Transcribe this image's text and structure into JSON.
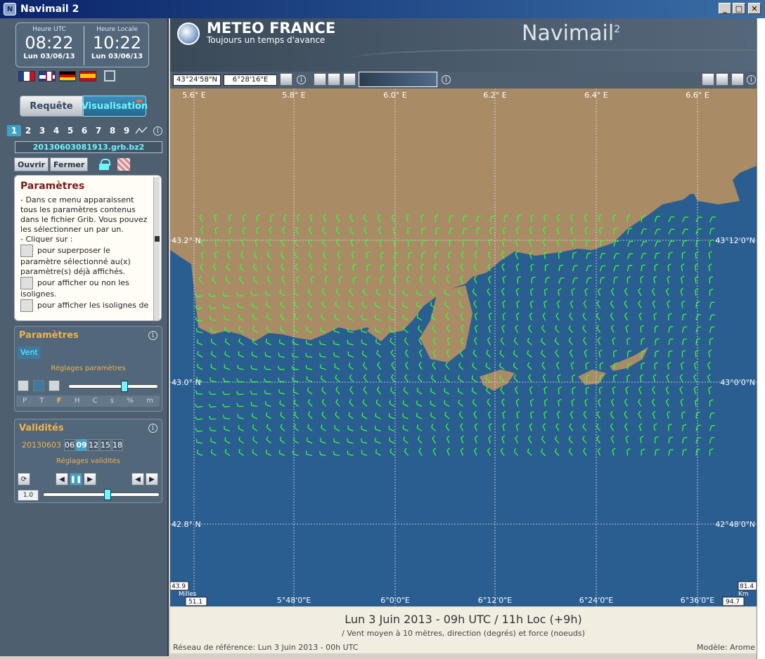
{
  "window": {
    "title": "Navimail 2"
  },
  "clock": {
    "utc_label": "Heure UTC",
    "utc_time": "08:22",
    "utc_date": "Lun 03/06/13",
    "local_label": "Heure Locale",
    "local_time": "10:22",
    "local_date": "Lun 03/06/13"
  },
  "modes": {
    "request": "Requête",
    "visualisation": "Visualisation"
  },
  "file_tabs": [
    "1",
    "2",
    "3",
    "4",
    "5",
    "6",
    "7",
    "8",
    "9"
  ],
  "file_name": "20130603081913.grb.bz2",
  "file_buttons": {
    "open": "Ouvrir",
    "close": "Fermer"
  },
  "help": {
    "title": "Paramètres",
    "p1": "- Dans ce menu apparaissent tous les paramètres contenus dans le fichier Grib. Vous pouvez les sélectionner un par un.",
    "p2": "- Cliquer sur :",
    "p3": "pour superposer le paramètre sélectionné au(x) paramètre(s) déjà affichés.",
    "p4": "pour afficher ou non les isolignes.",
    "p5": "pour afficher les isolignes de"
  },
  "params": {
    "title": "Paramètres",
    "selected": "Vent",
    "settings_label": "Réglages paramètres",
    "letters": [
      "P",
      "T",
      "F",
      "H",
      "C",
      "s",
      "%",
      "m"
    ],
    "active_letter": "F",
    "slider_level": 0.63
  },
  "validities": {
    "title": "Validités",
    "date": "20130603",
    "hours": [
      "06",
      "09",
      "12",
      "15",
      "18"
    ],
    "active_hour": "09",
    "settings_label": "Réglages validités",
    "speed": "1.0",
    "slider_level": 0.55
  },
  "banner": {
    "brand": "METEO FRANCE",
    "slogan": "Toujours un temps d'avance",
    "product": "Navimail",
    "product_sup": "2"
  },
  "toolbar": {
    "lat": "43°24'58\"N",
    "lon": "6°28'16\"E"
  },
  "map": {
    "top_lon_labels": [
      "5.6° E",
      "5.8° E",
      "6.0° E",
      "6.2° E",
      "6.4° E",
      "6.6° E"
    ],
    "bottom_lon_labels": [
      "5°48'0\"E",
      "6°0'0\"E",
      "6°12'0\"E",
      "6°24'0\"E",
      "6°36'0\"E"
    ],
    "left_lat_labels": [
      "43.2° N",
      "43.0° N",
      "42.8° N"
    ],
    "right_lat_labels": [
      "43°12'0\"N",
      "43°0'0\"N",
      "42°48'0\"N"
    ],
    "scale_left_top": "43.9",
    "scale_left_unit": "Milles",
    "scale_left_bottom": "51.1",
    "scale_right_top": "81.4",
    "scale_right_unit": "Km",
    "scale_right_bottom": "94.7",
    "colors": {
      "sea": "#2a5d90",
      "land": "#a98b66",
      "wind": "#33ff33",
      "grid": "#dde6f0"
    }
  },
  "footer": {
    "headline": "Lun 3 Juin 2013 - 09h UTC / 11h Loc (+9h)",
    "description": "/ Vent moyen à 10 mètres, direction (degrés) et force (noeuds)",
    "reference": "Réseau de référence: Lun 3 Juin 2013 - 00h UTC",
    "model": "Modèle: Arome"
  }
}
